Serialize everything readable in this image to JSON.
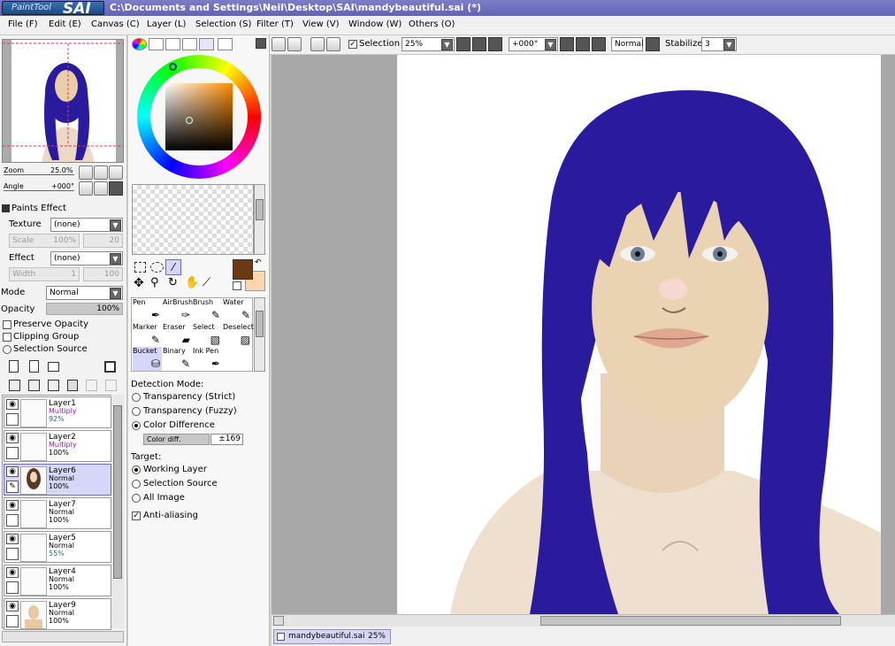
{
  "titlebar": {
    "logo_painttool": "PaintTool",
    "logo_sai": "SAI",
    "path": "C:\\Documents and Settings\\Neil\\Desktop\\SAI\\mandybeautiful.sai (*)"
  },
  "menu": [
    "File (F)",
    "Edit (E)",
    "Canvas (C)",
    "Layer (L)",
    "Selection (S)",
    "Filter (T)",
    "View (V)",
    "Window (W)",
    "Others (O)"
  ],
  "navigator": {
    "zoom_label": "Zoom",
    "zoom_value": "25.0%",
    "angle_label": "Angle",
    "angle_value": "+000°"
  },
  "paints_effect": {
    "header": "Paints Effect",
    "texture_label": "Texture",
    "texture_value": "(none)",
    "scale_label": "Scale",
    "scale_value": "100%",
    "scale_num": "20",
    "effect_label": "Effect",
    "effect_value": "(none)",
    "width_label": "Width",
    "width_value": "1",
    "width_num": "100"
  },
  "layer_props": {
    "mode_label": "Mode",
    "mode_value": "Normal",
    "opacity_label": "Opacity",
    "opacity_value": "100%",
    "preserve_opacity": "Preserve Opacity",
    "clipping_group": "Clipping Group",
    "selection_source": "Selection Source"
  },
  "layers": [
    {
      "name": "Layer1",
      "mode": "Multiply",
      "opacity": "92%",
      "selected": false
    },
    {
      "name": "Layer2",
      "mode": "Multiply",
      "opacity": "100%",
      "selected": false
    },
    {
      "name": "Layer6",
      "mode": "Normal",
      "opacity": "100%",
      "selected": true
    },
    {
      "name": "Layer7",
      "mode": "Normal",
      "opacity": "100%",
      "selected": false
    },
    {
      "name": "Layer5",
      "mode": "Normal",
      "opacity": "55%",
      "selected": false
    },
    {
      "name": "Layer4",
      "mode": "Normal",
      "opacity": "100%",
      "selected": false
    },
    {
      "name": "Layer9",
      "mode": "Normal",
      "opacity": "100%",
      "selected": false
    }
  ],
  "colors": {
    "primary": "#6b3a12",
    "secondary": "#fcd6b0",
    "hair": "#2a1a9e",
    "selected_layer": "#d6d6f8"
  },
  "tools": [
    {
      "label": "Pen",
      "icon": "pen-icon"
    },
    {
      "label": "AirBrush",
      "icon": "airbrush-icon"
    },
    {
      "label": "Brush",
      "icon": "brush-icon"
    },
    {
      "label": "Water",
      "icon": "water-icon"
    },
    {
      "label": "Marker",
      "icon": "marker-icon"
    },
    {
      "label": "Eraser",
      "icon": "eraser-icon"
    },
    {
      "label": "Select",
      "icon": "select-icon"
    },
    {
      "label": "Deselect",
      "icon": "deselect-icon"
    },
    {
      "label": "Bucket",
      "icon": "bucket-icon"
    },
    {
      "label": "Binary",
      "icon": "binary-icon"
    },
    {
      "label": "Ink Pen",
      "icon": "inkpen-icon"
    }
  ],
  "bucket_options": {
    "detection_header": "Detection Mode:",
    "detect_strict": "Transparency (Strict)",
    "detect_fuzzy": "Transparency (Fuzzy)",
    "detect_color": "Color Difference",
    "color_diff_label": "Color diff.",
    "color_diff_value": "±169",
    "target_header": "Target:",
    "target_working": "Working Layer",
    "target_selection": "Selection Source",
    "target_all": "All Image",
    "anti_aliasing": "Anti-aliasing"
  },
  "canvas_toolbar": {
    "selection_label": "Selection",
    "zoom_value": "25%",
    "angle_value": "+000°",
    "blend_mode": "Normal",
    "stabilizer_label": "Stabilizer",
    "stabilizer_value": "3"
  },
  "taskbar": {
    "file_name": "mandybeautiful.sai",
    "file_zoom": "25%"
  }
}
